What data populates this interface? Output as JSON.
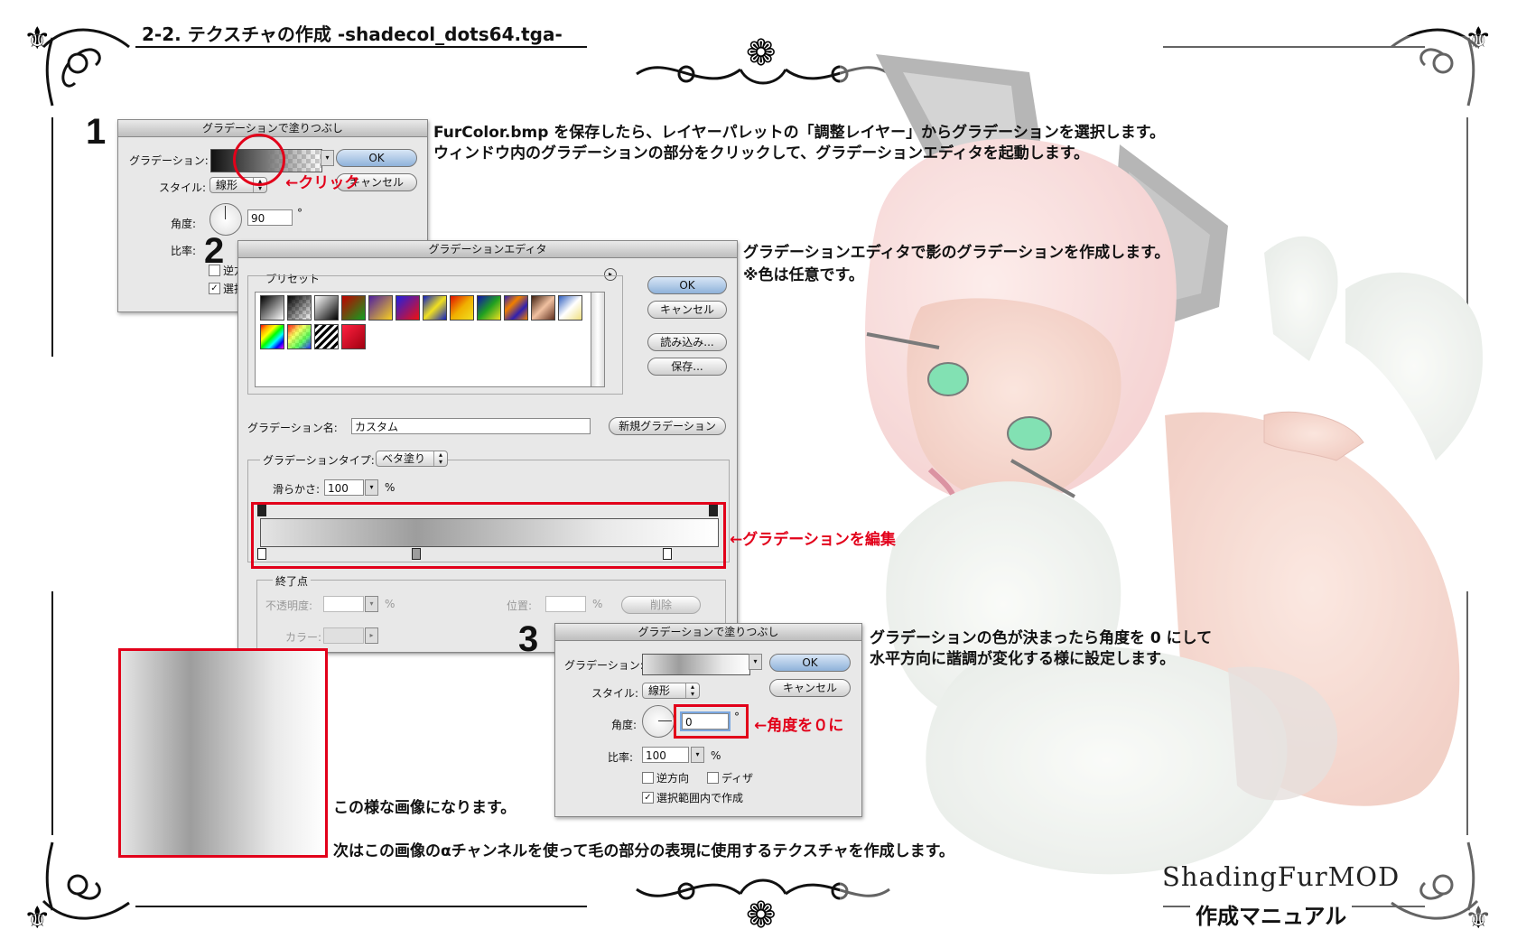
{
  "header": {
    "title": "2-2. テクスチャの作成 -shadecol_dots64.tga-"
  },
  "steps": {
    "s1": "1",
    "s2": "2",
    "s3": "3"
  },
  "instructions": {
    "step1_line1": "FurColor.bmp を保存したら、レイヤーパレットの「調整レイヤー」からグラデーションを選択します。",
    "step1_line2": "ウィンドウ内のグラデーションの部分をクリックして、グラデーションエディタを起動します。",
    "step2_line1": "グラデーションエディタで影のグラデーションを作成します。",
    "step2_line2": "※色は任意です。",
    "step3_line1": "グラデーションの色が決まったら角度を 0 にして",
    "step3_line2": "水平方向に諧調が変化する様に設定します。",
    "result_line1": "この様な画像になります。",
    "result_line2": "次はこの画像のαチャンネルを使って毛の部分の表現に使用するテクスチャを作成します。"
  },
  "annotations": {
    "click": "←クリック",
    "edit_gradient": "←グラデーションを編集",
    "angle_zero": "←角度を０に"
  },
  "dialog1": {
    "title": "グラデーションで塗りつぶし",
    "gradient_label": "グラデーション:",
    "style_label": "スタイル:",
    "style_value": "線形",
    "angle_label": "角度:",
    "angle_value": "90",
    "degree": "°",
    "scale_label": "比率:",
    "ok": "OK",
    "cancel": "キャンセル",
    "reverse_partial": "逆方",
    "select_partial": "選択"
  },
  "editor": {
    "title": "グラデーションエディタ",
    "presets_label": "プリセット",
    "ok": "OK",
    "cancel": "キャンセル",
    "load": "読み込み...",
    "save": "保存...",
    "name_label": "グラデーション名:",
    "name_value": "カスタム",
    "new_gradient": "新規グラデーション",
    "type_label": "グラデーションタイプ:",
    "type_value": "ベタ塗り",
    "smooth_label": "滑らかさ:",
    "smooth_value": "100",
    "percent": "%",
    "endpoint_label": "終了点",
    "opacity_label": "不透明度:",
    "location_label": "位置:",
    "delete": "削除",
    "color_label": "カラー:",
    "swatches": [
      "#000000 to #ffffff",
      "#000000 to transparent",
      "#ffffff to #000000",
      "#c00000 to #10a020",
      "#f8d020 to #5020a0",
      "#2020e0 to #f01010",
      "#1020c0 to #f0e020",
      "#f0b000 to #e01000",
      "#1010b0 to #20a020",
      "#f08000 to #3020b0",
      "#402010 to #f0c0a0",
      "#3060c0 to #f0e080",
      "#ff0000 rainbow",
      "#ff0000 rainbow transparent",
      "#000000 stripes",
      "#a00010 to #ff2040"
    ]
  },
  "dialog3": {
    "title": "グラデーションで塗りつぶし",
    "gradient_label": "グラデーション:",
    "style_label": "スタイル:",
    "style_value": "線形",
    "angle_label": "角度:",
    "angle_value": "0",
    "degree": "°",
    "scale_label": "比率:",
    "scale_value": "100",
    "percent": "%",
    "reverse": "逆方向",
    "dither": "ディザ",
    "align": "選択範囲内で作成",
    "ok": "OK",
    "cancel": "キャンセル"
  },
  "footer": {
    "logo": "ShadingFurMOD",
    "subtitle": "作成マニュアル"
  },
  "colors": {
    "accent_red": "#e2001a",
    "ink": "#111111"
  }
}
